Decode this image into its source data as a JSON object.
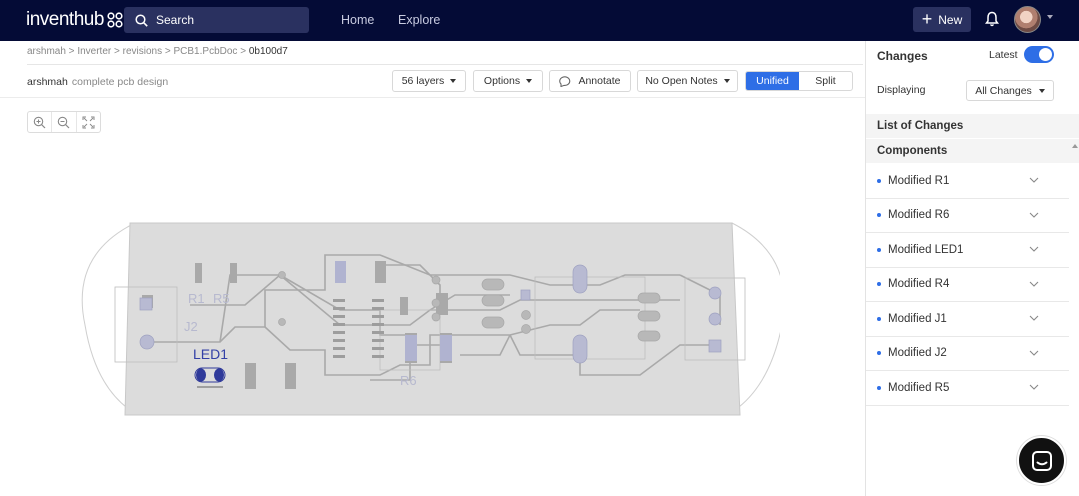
{
  "app": {
    "logo_text": "inventhub"
  },
  "topbar": {
    "search_label": "Search",
    "nav": [
      "Home",
      "Explore"
    ],
    "new_label": "New"
  },
  "breadcrumb": {
    "parts": [
      "arshmah",
      "Inverter",
      "revisions",
      "PCB1.PcbDoc"
    ],
    "separator": " > ",
    "current": "0b100d7"
  },
  "commit": {
    "author": "arshmah",
    "message": "complete pcb design"
  },
  "toolbar": {
    "layers_label": "56 layers",
    "options_label": "Options",
    "annotate_label": "Annotate",
    "notes_label": "No Open Notes",
    "view_modes": [
      "Unified",
      "Split"
    ],
    "active_view": "Unified"
  },
  "pcb": {
    "silk_labels": [
      "R1",
      "R5",
      "J2",
      "LED1",
      "R6"
    ]
  },
  "panel": {
    "title": "Changes",
    "latest_label": "Latest",
    "latest_on": true,
    "displaying_label": "Displaying",
    "displaying_value": "All Changes",
    "list_header": "List of Changes",
    "group_header": "Components",
    "changes": [
      "Modified R1",
      "Modified R6",
      "Modified LED1",
      "Modified R4",
      "Modified J1",
      "Modified J2",
      "Modified R5"
    ]
  },
  "colors": {
    "nav_bg": "#040b36",
    "accent": "#2e6ee6"
  }
}
